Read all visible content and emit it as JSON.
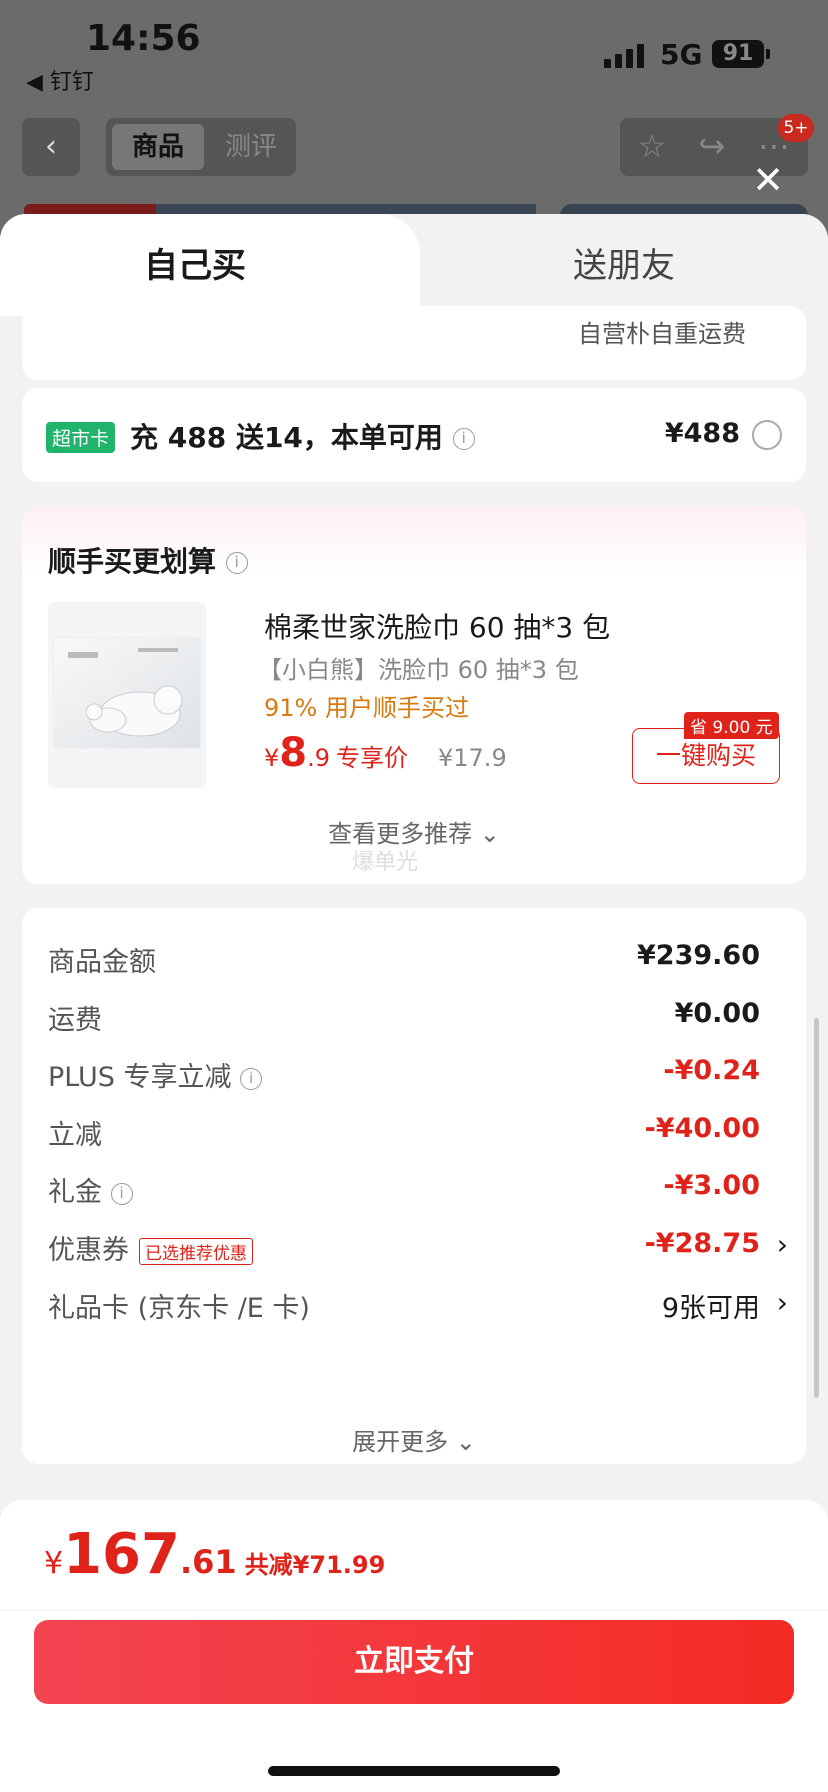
{
  "status_bar": {
    "time": "14:56",
    "back_app": "◀ 钉钉",
    "network": "5G",
    "battery": "91"
  },
  "background": {
    "segments": [
      "商品",
      "测评"
    ],
    "badge": "5+"
  },
  "tabs": {
    "active": "自己买",
    "inactive": "送朋友"
  },
  "partial_card": {
    "text": "自营朴自重运费"
  },
  "supermarket_card": {
    "tag": "超市卡",
    "text": "充 488 送14，本单可用",
    "price": "¥488"
  },
  "recommendation": {
    "title": "顺手买更划算",
    "product": {
      "name": "棉柔世家洗脸巾 60 抽*3 包",
      "subtitle": "【小白熊】洗脸巾 60 抽*3 包",
      "stat": "91% 用户顺手买过",
      "price_yen": "¥",
      "price_int": "8",
      "price_dec": ".9",
      "price_label": "专享价",
      "old_price": "¥17.9",
      "save_tag": "省 9.00 元",
      "buy_label": "一键购买"
    },
    "more_label": "查看更多推荐 ⌄",
    "watermark": "爆单光"
  },
  "summary": {
    "rows": [
      {
        "label": "商品金额",
        "value": "¥239.60"
      },
      {
        "label": "运费",
        "value": "¥0.00"
      },
      {
        "label": "PLUS 专享立减",
        "value": "-¥0.24"
      },
      {
        "label": "立减",
        "value": "-¥40.00"
      },
      {
        "label": "礼金",
        "value": "-¥3.00"
      },
      {
        "label": "优惠券",
        "tag": "已选推荐优惠",
        "value": "-¥28.75"
      },
      {
        "label": "礼品卡 (京东卡 /E 卡)",
        "value": "9张可用"
      }
    ],
    "expand_label": "展开更多 ⌄"
  },
  "footer": {
    "total_yen": "¥",
    "total_int": "167",
    "total_dec": ".61",
    "total_save": "共减¥71.99",
    "pay_label": "立即支付"
  },
  "colors": {
    "accent": "#e0231a",
    "pay_start": "#f34452",
    "pay_end": "#f42b24",
    "super_tag": "#1fb36b",
    "stat": "#d77a10"
  }
}
